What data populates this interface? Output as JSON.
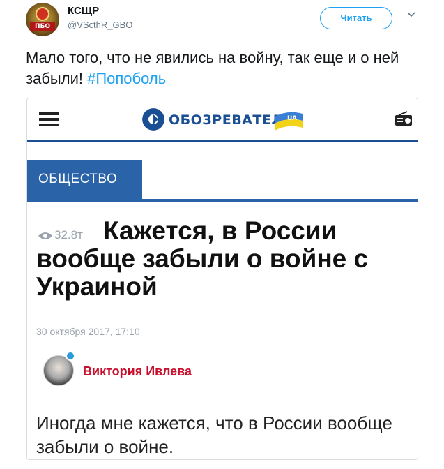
{
  "tweet": {
    "author_name": "КСЩР",
    "author_handle": "@VScthR_GBO",
    "avatar_label": "ПБО",
    "follow_label": "Читать",
    "text": "Мало того, что не явились на войну, так еще и о ней забыли! ",
    "hashtag": "#Попоболь"
  },
  "article": {
    "site_name": "ОБОЗРЕВАТЕЛЬ",
    "site_badge": "UA",
    "section": "ОБЩЕСТВО",
    "views": "32.8т",
    "headline": "Кажется, в России вообще забыли о войне с Украиной",
    "date": "30 октября 2017, 17:10",
    "author": "Виктория Ивлева",
    "lead": "Иногда мне кажется, что в России вообще забыли о войне."
  },
  "colors": {
    "twitter_blue": "#1da1f2",
    "site_blue": "#1b4f93",
    "section_blue": "#2a63a8",
    "author_red": "#c8102e"
  },
  "icons": [
    "chevron-down-icon",
    "hamburger-menu-icon",
    "globe-logo-icon",
    "radio-icon",
    "eye-icon",
    "verified-badge-icon"
  ]
}
